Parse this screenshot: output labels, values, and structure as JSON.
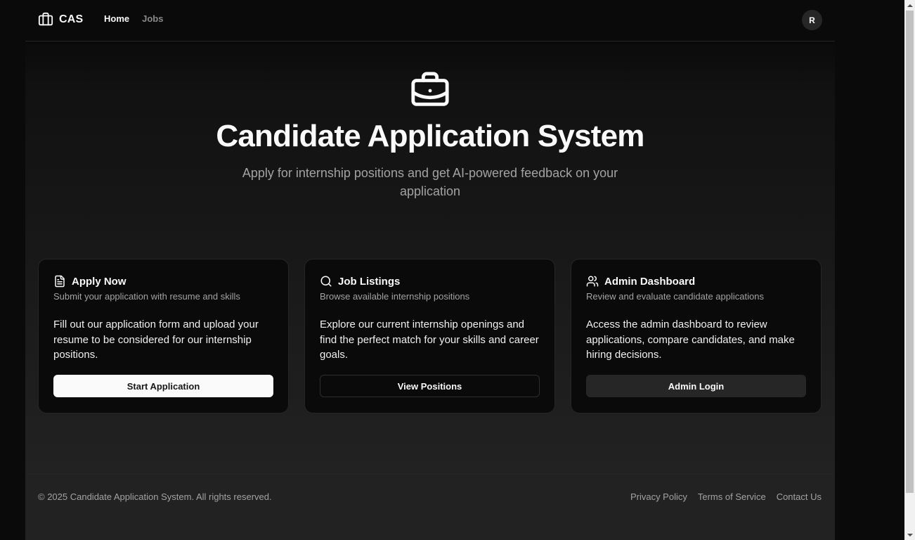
{
  "header": {
    "brand_icon": "briefcase-icon",
    "brand_name": "CAS",
    "nav": {
      "home": "Home",
      "jobs": "Jobs"
    },
    "avatar_initial": "R"
  },
  "hero": {
    "icon": "briefcase-icon",
    "title": "Candidate Application System",
    "subtitle": "Apply for internship positions and get AI-powered feedback on your application"
  },
  "cards": [
    {
      "icon": "file-text-icon",
      "title": "Apply Now",
      "description": "Submit your application with resume and skills",
      "body": "Fill out our application form and upload your resume to be considered for our internship positions.",
      "button": "Start Application"
    },
    {
      "icon": "search-icon",
      "title": "Job Listings",
      "description": "Browse available internship positions",
      "body": "Explore our current internship openings and find the perfect match for your skills and career goals.",
      "button": "View Positions"
    },
    {
      "icon": "users-icon",
      "title": "Admin Dashboard",
      "description": "Review and evaluate candidate applications",
      "body": "Access the admin dashboard to review applications, compare candidates, and make hiring decisions.",
      "button": "Admin Login"
    }
  ],
  "footer": {
    "copyright": "© 2025 Candidate Application System. All rights reserved.",
    "links": {
      "privacy": "Privacy Policy",
      "terms": "Terms of Service",
      "contact": "Contact Us"
    }
  },
  "colors": {
    "background": "#0a0a0a",
    "card_border": "#262626",
    "text_primary": "#fafafa",
    "text_muted": "#a3a3a3"
  }
}
